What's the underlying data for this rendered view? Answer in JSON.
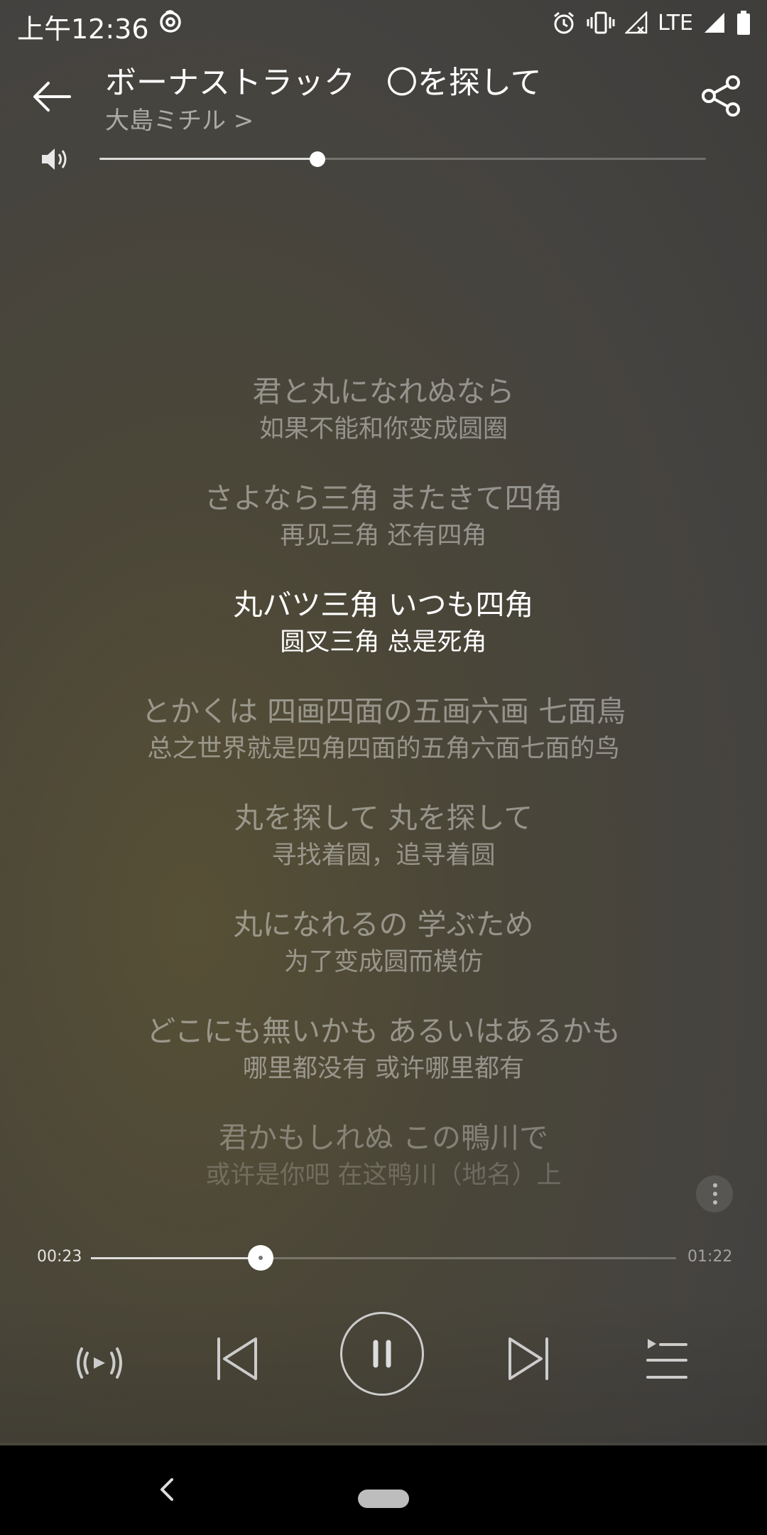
{
  "status_bar": {
    "time": "上午12:36",
    "network": "LTE",
    "icons": [
      "netease-music-icon",
      "alarm-icon",
      "vibrate-icon",
      "signal-icon",
      "signal-icon",
      "battery-icon"
    ]
  },
  "header": {
    "title": "ボーナストラック　〇を探して",
    "artist": "大島ミチル >",
    "back_icon": "back-arrow-icon",
    "share_icon": "share-icon"
  },
  "volume": {
    "icon": "speaker-icon",
    "level": 0.36
  },
  "lyrics": [
    {
      "jp": "君と丸になれぬなら",
      "cn": "如果不能和你变成圆圈",
      "state": "normal"
    },
    {
      "jp": "さよなら三角 またきて四角",
      "cn": "再见三角 还有四角",
      "state": "normal"
    },
    {
      "jp": "丸バツ三角 いつも四角",
      "cn": "圆叉三角 总是死角",
      "state": "active"
    },
    {
      "jp": "とかくは 四画四面の五画六画 七面鳥",
      "cn": "总之世界就是四角四面的五角六面七面的鸟",
      "state": "normal"
    },
    {
      "jp": "丸を探して 丸を探して",
      "cn": "寻找着圆，追寻着圆",
      "state": "normal"
    },
    {
      "jp": "丸になれるの 学ぶため",
      "cn": "为了变成圆而模仿",
      "state": "normal"
    },
    {
      "jp": "どこにも無いかも あるいはあるかも",
      "cn": "哪里都没有 或许哪里都有",
      "state": "normal"
    },
    {
      "jp": "君かもしれぬ この鴨川で",
      "cn": "或许是你吧 在这鸭川（地名）上",
      "state": "fade"
    }
  ],
  "playback": {
    "current_time": "00:23",
    "total_time": "01:22",
    "progress": 0.29
  },
  "controls": {
    "items": [
      "radio-broadcast-icon",
      "previous-icon",
      "pause-icon",
      "next-icon",
      "playlist-icon"
    ],
    "state": "playing"
  },
  "nav_bar": {
    "items": [
      "nav-back-icon",
      "home-pill"
    ]
  }
}
